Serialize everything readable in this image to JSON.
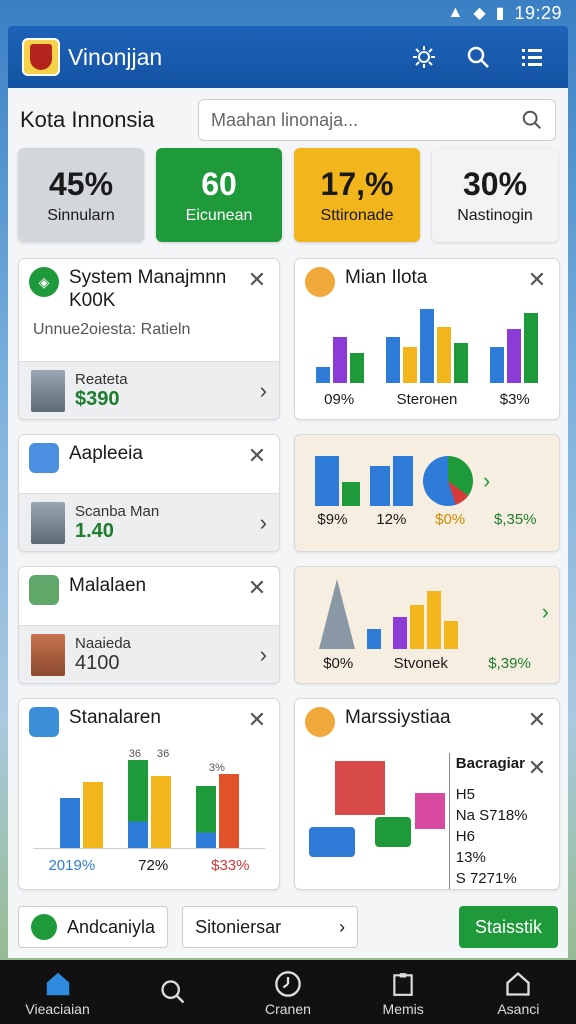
{
  "status": {
    "time": "19:29"
  },
  "header": {
    "title": "Vinonjjan"
  },
  "page": {
    "title": "Kota Innonsia"
  },
  "search": {
    "placeholder": "Maahan linonaja..."
  },
  "stats": [
    {
      "value": "45%",
      "label": "Sinnularn",
      "bg": "#d3d6da",
      "fg": "#1a1a1a"
    },
    {
      "value": "60",
      "label": "Eicunean",
      "bg": "#1f9a3b",
      "fg": "#ffffff"
    },
    {
      "value": "17,%",
      "label": "Sttironade",
      "bg": "#f2b51b",
      "fg": "#1a1a1a"
    },
    {
      "value": "30%",
      "label": "Nastinogin",
      "bg": "#f3f3f3",
      "fg": "#1a1a1a"
    }
  ],
  "cards": {
    "system": {
      "title": "System Manajmnn K00K",
      "sub": "Unnue2oiesta: Ratieln",
      "row_label": "Reateta",
      "row_value": "$390"
    },
    "mian": {
      "title": "Mian Ilota",
      "captions": [
        "09%",
        "Sterонen",
        "$3%"
      ]
    },
    "aapleeia": {
      "title": "Aapleeia",
      "row_label": "Scanba Man",
      "row_value": "1.40"
    },
    "chart2": {
      "captions": [
        "$9%",
        "12%",
        "$0%",
        "$,35%"
      ]
    },
    "malalaen": {
      "title": "Malalaen",
      "row_label": "Naaieda",
      "row_value": "4100"
    },
    "chart3": {
      "captions": [
        "$0%",
        "Stvonek",
        "$,39%"
      ]
    },
    "stanalaren": {
      "title": "Stanalaren",
      "captions": [
        "2019%",
        "72%",
        "$33%"
      ],
      "top_labels": [
        "36",
        "36",
        "3%"
      ]
    },
    "marssiystiaa": {
      "title": "Marssiystiaa",
      "side_title": "Bacragiar",
      "side_lines": [
        "H5",
        "Na S718%",
        "H6",
        "13%",
        "S 7271%"
      ]
    }
  },
  "actions": {
    "left": "Andcaniyla",
    "middle": "Sitoniersar",
    "green": "Staisstik"
  },
  "nav": [
    {
      "label": "Vieaciaian",
      "icon": "home-icon"
    },
    {
      "label": "",
      "icon": "search-icon"
    },
    {
      "label": "Cranen",
      "icon": "clock-icon"
    },
    {
      "label": "Memis",
      "icon": "clipboard-icon"
    },
    {
      "label": "Asanci",
      "icon": "house-outline-icon"
    }
  ]
}
